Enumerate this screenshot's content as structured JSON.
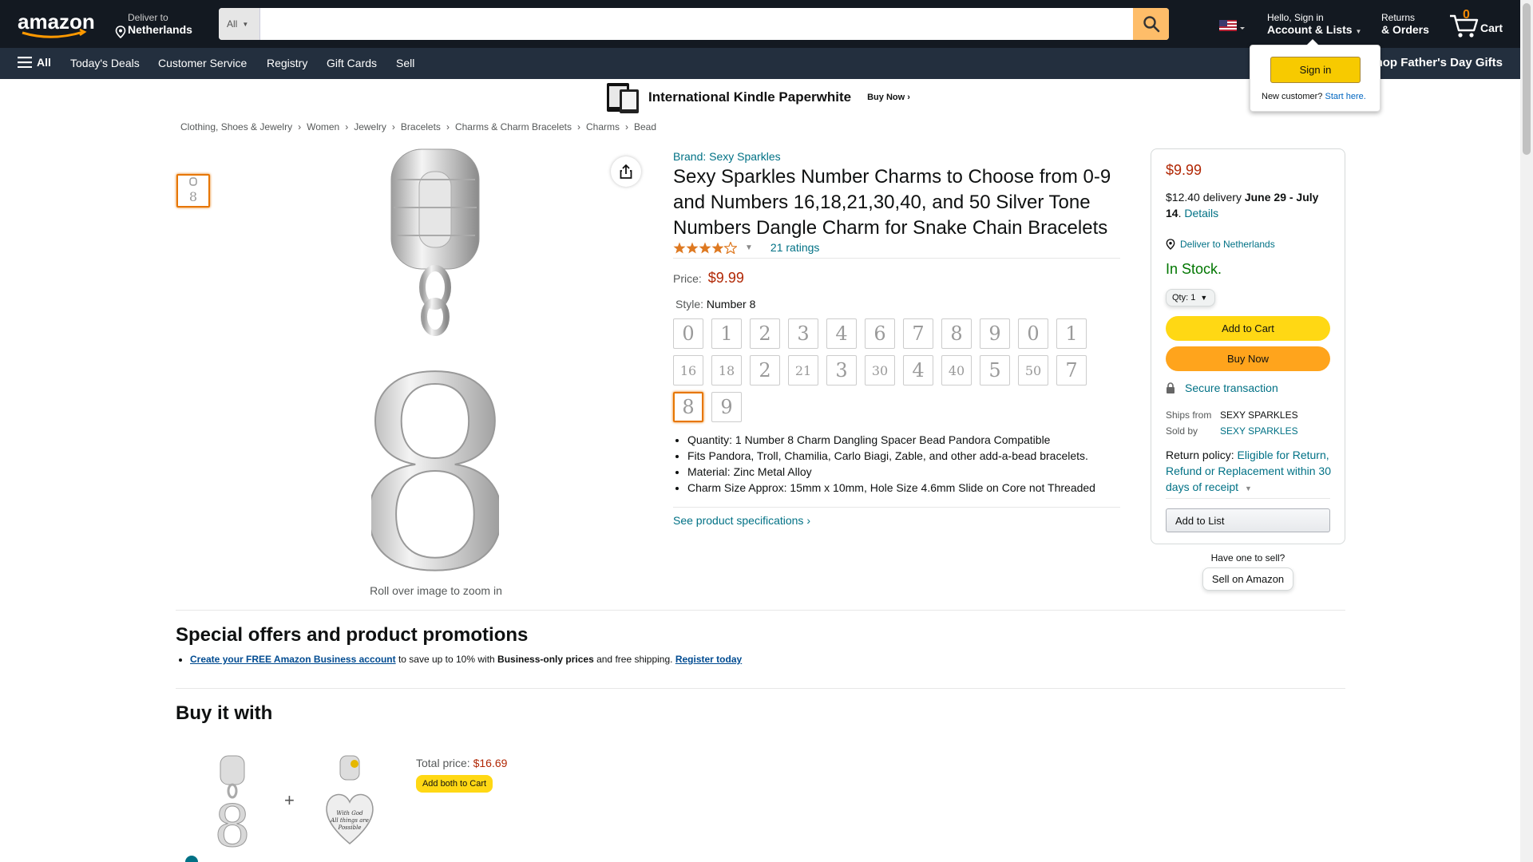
{
  "nav": {
    "deliver_line1": "Deliver to",
    "deliver_line2": "Netherlands",
    "search_category": "All",
    "search_placeholder": "",
    "account_line1": "Hello, Sign in",
    "account_line2": "Account & Lists",
    "returns_line1": "Returns",
    "returns_line2": "& Orders",
    "cart_count": "0",
    "cart_label": "Cart",
    "brand_color": "#131921",
    "accent_color": "#febd69"
  },
  "subnav": {
    "all": "All",
    "items": [
      "Today's Deals",
      "Customer Service",
      "Registry",
      "Gift Cards",
      "Sell"
    ],
    "promo": "Shop Father's Day Gifts"
  },
  "signin_flyout": {
    "button": "Sign in",
    "new_customer": "New customer?",
    "start_here": "Start here."
  },
  "banner": {
    "title": "International Kindle Paperwhite",
    "cta": "Buy Now ›"
  },
  "breadcrumb": [
    "Clothing, Shoes & Jewelry",
    "Women",
    "Jewelry",
    "Bracelets",
    "Charms & Charm Bracelets",
    "Charms",
    "Bead"
  ],
  "gallery": {
    "zoom_hint": "Roll over image to zoom in",
    "main_glyph": "8"
  },
  "product": {
    "brand": "Brand: Sexy Sparkles",
    "title": "Sexy Sparkles Number Charms to Choose from 0-9 and Numbers 16,18,21,30,40, and 50 Silver Tone Numbers Dangle Charm for Snake Chain Bracelets",
    "rating_stars": 4,
    "ratings": "21 ratings",
    "price_label": "Price:",
    "price": "$9.99",
    "style_label": "Style:",
    "style_value": "Number 8",
    "swatches": [
      "0",
      "1",
      "2",
      "3",
      "4",
      "6",
      "7",
      "8",
      "9",
      "0",
      "1",
      "16",
      "18",
      "2",
      "21",
      "3",
      "30",
      "4",
      "40",
      "5",
      "50",
      "7",
      "8",
      "9"
    ],
    "selected_swatch": 22,
    "bullets": [
      "Quantity: 1 Number 8 Charm Dangling Spacer Bead Pandora Compatible",
      "Fits Pandora, Troll, Chamilia, Carlo Biagi, Zable, and other add-a-bead bracelets.",
      "Material: Zinc Metal Alloy",
      "Charm Size Approx: 15mm x 10mm, Hole Size 4.6mm Slide on Core not Threaded"
    ],
    "see_specs": "See product specifications ›"
  },
  "buybox": {
    "price": "$9.99",
    "delivery_prefix": "$12.40 delivery ",
    "delivery_dates": "June 29 - July 14",
    "delivery_details": "Details",
    "deliver_to": "Deliver to Netherlands",
    "stock": "In Stock.",
    "qty": "Qty: 1",
    "add_to_cart": "Add to Cart",
    "buy_now": "Buy Now",
    "secure": "Secure transaction",
    "ships_from_label": "Ships from",
    "ships_from": "SEXY SPARKLES",
    "sold_by_label": "Sold by",
    "sold_by": "SEXY SPARKLES",
    "return_label": "Return policy: ",
    "return_link": "Eligible for Return, Refund or Replacement within 30 days of receipt",
    "add_to_list": "Add to List",
    "have_one": "Have one to sell?",
    "sell_on_amazon": "Sell on Amazon"
  },
  "offers": {
    "heading": "Special offers and product promotions",
    "link1": "Create your FREE Amazon Business account",
    "text1": " to save up to 10% with ",
    "bold1": "Business-only prices",
    "text2": " and free shipping. ",
    "link2": "Register today"
  },
  "buy_with": {
    "heading": "Buy it with",
    "plus": "+",
    "total_label": "Total price: ",
    "total_value": "$16.69",
    "add_both": "Add both to Cart",
    "item2_text": "With God All things are Possible"
  }
}
